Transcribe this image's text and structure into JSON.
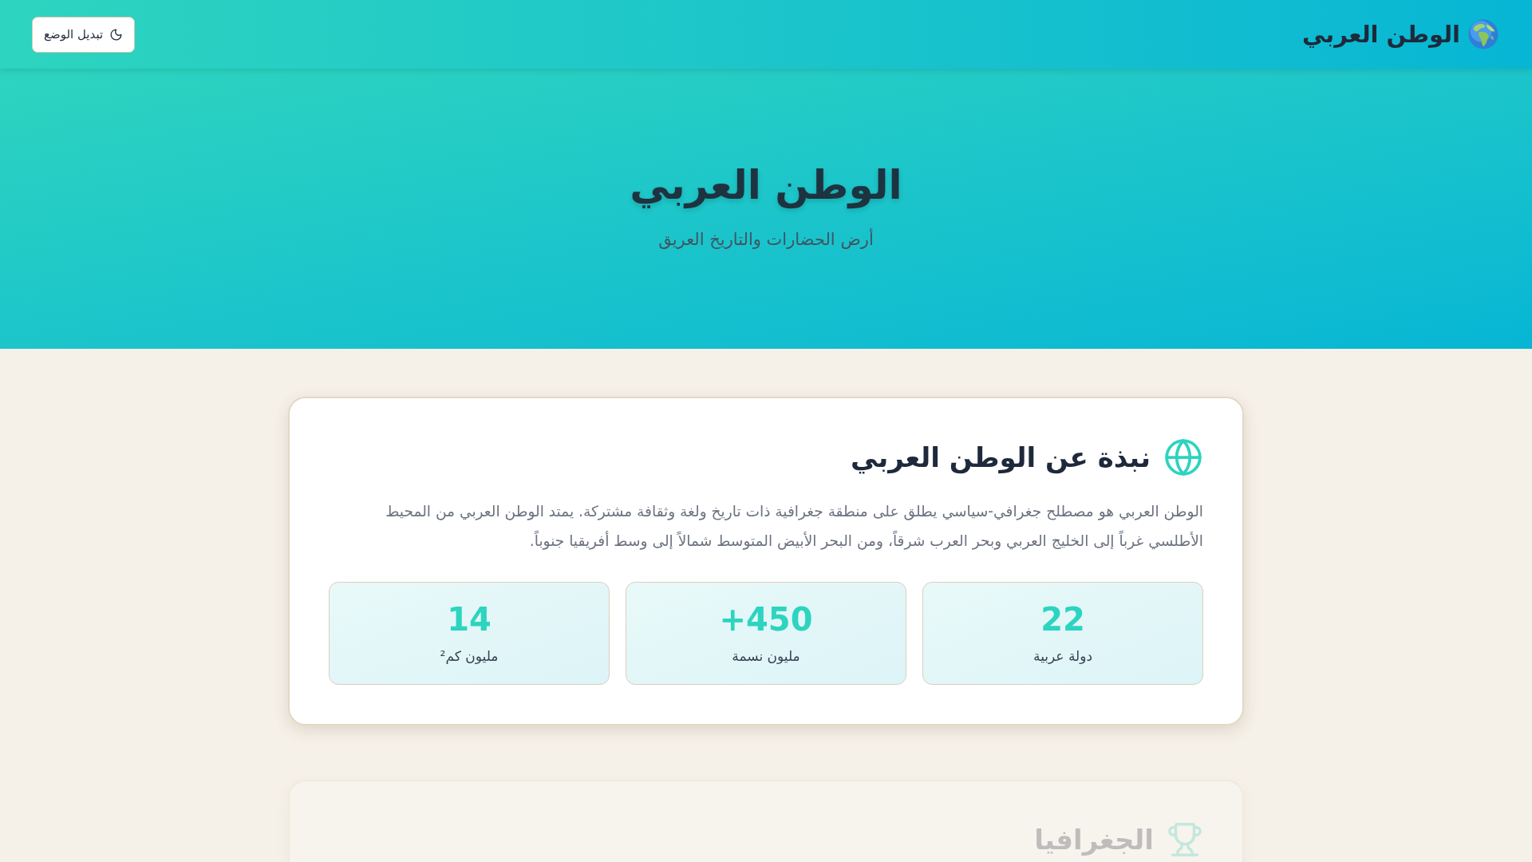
{
  "header": {
    "brand": {
      "title": "الوطن العربي"
    },
    "theme_toggle": {
      "label": "تبديل الوضع"
    }
  },
  "hero": {
    "title": "الوطن العربي",
    "subtitle": "أرض الحضارات والتاريخ العريق"
  },
  "sections": [
    {
      "heading": "نبذة عن الوطن العربي",
      "dimmed": false,
      "paragraph": "الوطن العربي هو مصطلح جغرافي-سياسي يطلق على منطقة جغرافية ذات تاريخ ولغة وثقافة مشتركة. يمتد الوطن العربي من المحيط الأطلسي غرباً إلى الخليج العربي وبحر العرب شرقاً، ومن البحر الأبيض المتوسط شمالاً إلى وسط أفريقيا جنوباً.",
      "stats": [
        {
          "value": "22",
          "label": "دولة عربية"
        },
        {
          "value": "+450",
          "label": "مليون نسمة"
        },
        {
          "value": "14",
          "label": "مليون كم²"
        }
      ]
    },
    {
      "heading": "الجغرافيا",
      "dimmed": true
    }
  ]
}
